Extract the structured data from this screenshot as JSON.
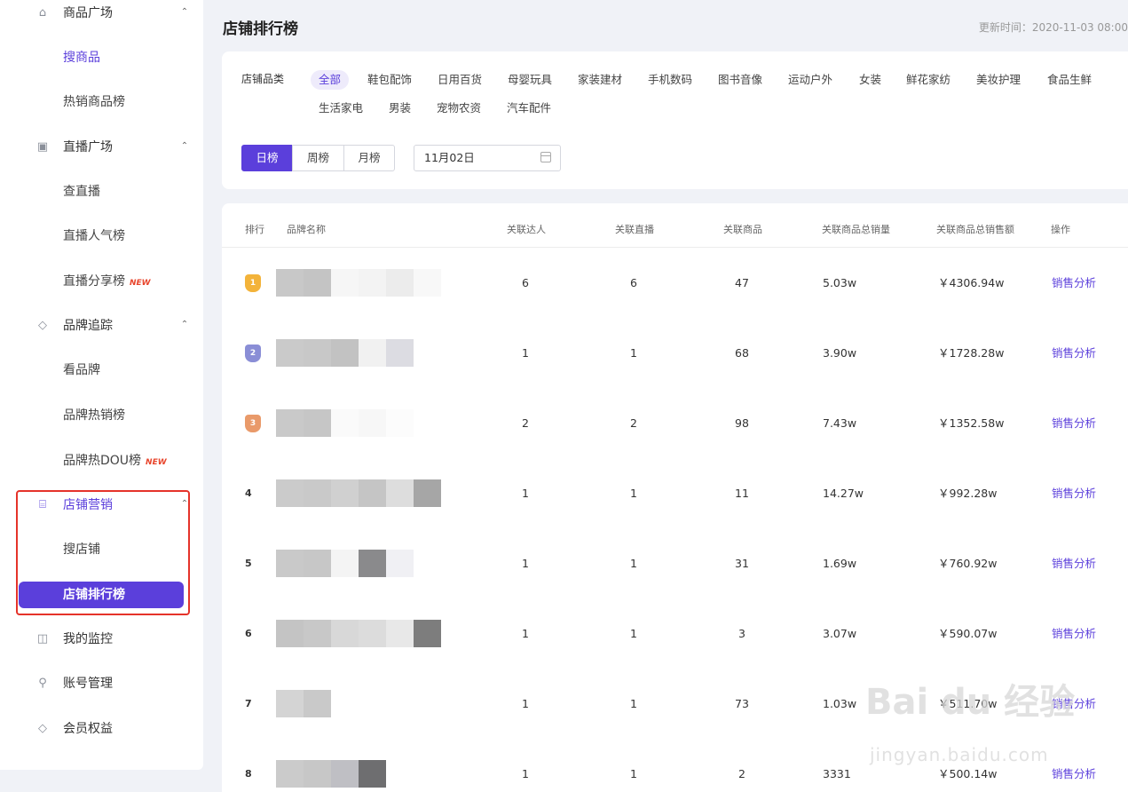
{
  "sidebar": {
    "groups": [
      {
        "label": "商品广场",
        "icon": "bag-icon",
        "chevron": "⌃"
      },
      {
        "label": "直播广场",
        "icon": "tv-icon",
        "chevron": "⌃"
      },
      {
        "label": "品牌追踪",
        "icon": "tag-icon",
        "chevron": "⌃"
      },
      {
        "label": "店铺营销",
        "icon": "store-icon",
        "chevron": "⌃"
      },
      {
        "label": "我的监控",
        "icon": "monitor-chart-icon"
      },
      {
        "label": "账号管理",
        "icon": "user-icon"
      },
      {
        "label": "会员权益",
        "icon": "diamond-icon"
      }
    ],
    "subitems": [
      {
        "label": "搜商品"
      },
      {
        "label": "热销商品榜"
      },
      {
        "label": "查直播"
      },
      {
        "label": "直播人气榜"
      },
      {
        "label": "直播分享榜",
        "badge": "NEW"
      },
      {
        "label": "看品牌"
      },
      {
        "label": "品牌热销榜"
      },
      {
        "label": "品牌热DOU榜",
        "badge": "NEW"
      },
      {
        "label": "搜店铺"
      },
      {
        "label": "店铺排行榜"
      }
    ]
  },
  "header": {
    "title": "店铺排行榜",
    "update_time": "更新时间：2020-11-03 08:00"
  },
  "filter": {
    "category_label": "店铺品类",
    "categories": [
      "全部",
      "鞋包配饰",
      "日用百货",
      "母婴玩具",
      "家装建材",
      "手机数码",
      "图书音像",
      "运动户外",
      "女装",
      "鲜花家纺",
      "美妆护理",
      "食品生鲜",
      "生活家电",
      "男装",
      "宠物农资",
      "汽车配件"
    ],
    "active_category": "全部",
    "periods": [
      "日榜",
      "周榜",
      "月榜"
    ],
    "active_period": "日榜",
    "date": "11月02日"
  },
  "table": {
    "columns": [
      "排行",
      "品牌名称",
      "关联达人",
      "关联直播",
      "关联商品",
      "关联商品总销量",
      "关联商品总销售额",
      "操作"
    ],
    "rows": [
      {
        "rank": "1",
        "influencers": "6",
        "lives": "6",
        "products": "47",
        "volume": "5.03w",
        "sales": "￥4306.94w",
        "action": "销售分析"
      },
      {
        "rank": "2",
        "influencers": "1",
        "lives": "1",
        "products": "68",
        "volume": "3.90w",
        "sales": "￥1728.28w",
        "action": "销售分析"
      },
      {
        "rank": "3",
        "influencers": "2",
        "lives": "2",
        "products": "98",
        "volume": "7.43w",
        "sales": "￥1352.58w",
        "action": "销售分析"
      },
      {
        "rank": "4",
        "influencers": "1",
        "lives": "1",
        "products": "11",
        "volume": "14.27w",
        "sales": "￥992.28w",
        "action": "销售分析"
      },
      {
        "rank": "5",
        "influencers": "1",
        "lives": "1",
        "products": "31",
        "volume": "1.69w",
        "sales": "￥760.92w",
        "action": "销售分析"
      },
      {
        "rank": "6",
        "influencers": "1",
        "lives": "1",
        "products": "3",
        "volume": "3.07w",
        "sales": "￥590.07w",
        "action": "销售分析"
      },
      {
        "rank": "7",
        "influencers": "1",
        "lives": "1",
        "products": "73",
        "volume": "1.03w",
        "sales": "￥511.70w",
        "action": "销售分析"
      },
      {
        "rank": "8",
        "influencers": "1",
        "lives": "1",
        "products": "2",
        "volume": "3331",
        "sales": "￥500.14w",
        "action": "销售分析"
      }
    ]
  },
  "watermark": {
    "text": "Bai du 经验",
    "url": "jingyan.baidu.com"
  },
  "colors": {
    "accent": "#5b3fdb",
    "highlight": "#e5332a",
    "background": "#f0f2f7"
  }
}
